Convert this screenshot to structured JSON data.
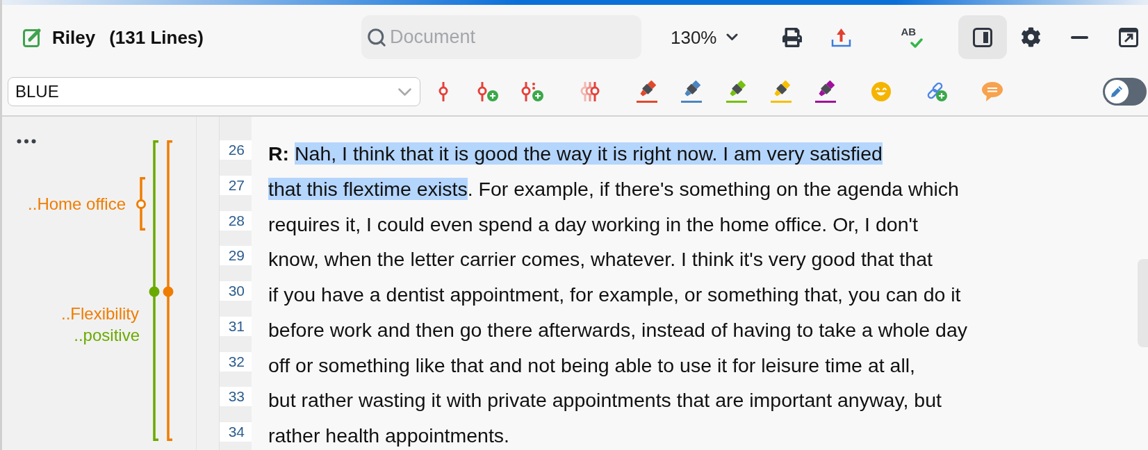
{
  "header": {
    "title": "Riley",
    "line_count": "(131 Lines)",
    "search": {
      "placeholder": "Document"
    },
    "zoom": "130%",
    "spellcheck": {
      "label": "AB"
    },
    "panel_toggle": {
      "on": true
    }
  },
  "toolbar": {
    "code_selector": {
      "value": "BLUE"
    },
    "highlighters": [
      {
        "color": "#e2482a"
      },
      {
        "color": "#4a86bf"
      },
      {
        "color": "#76c00e"
      },
      {
        "color": "#f6bf00"
      },
      {
        "color": "#a0109c"
      }
    ],
    "edit_mode": {
      "on": false
    }
  },
  "margin": {
    "codings": [
      {
        "label": "..Home office",
        "color": "#ef7d00",
        "kind": "hollow"
      },
      {
        "label": "..Flexibility",
        "color": "#ef7d00",
        "kind": "filled"
      },
      {
        "label": "..positive",
        "color": "#6aaa00",
        "kind": "filled"
      }
    ]
  },
  "transcript": {
    "lines": [
      {
        "number": "26",
        "segments": [
          {
            "text": "R: ",
            "kind": "speaker",
            "selected": false
          },
          {
            "text": "Nah, I think that it is good the way it is right now. I am very satisfied",
            "kind": "plain",
            "selected": true
          }
        ]
      },
      {
        "number": "27",
        "segments": [
          {
            "text": "that this flextime exists",
            "kind": "plain",
            "selected": true
          },
          {
            "text": ". For example, if there's something on the agenda which",
            "kind": "plain",
            "selected": false
          }
        ]
      },
      {
        "number": "28",
        "segments": [
          {
            "text": "requires it, I could even spend a day working in the home office. Or, I don't",
            "kind": "plain",
            "selected": false
          }
        ]
      },
      {
        "number": "29",
        "segments": [
          {
            "text": "know, when the letter carrier comes, whatever. I think it's very good that that",
            "kind": "plain",
            "selected": false
          }
        ]
      },
      {
        "number": "30",
        "segments": [
          {
            "text": "if you have a dentist appointment, for example, or something that, you can do it",
            "kind": "plain",
            "selected": false
          }
        ]
      },
      {
        "number": "31",
        "segments": [
          {
            "text": "before work and then go there afterwards, instead of having to take a whole day",
            "kind": "plain",
            "selected": false
          }
        ]
      },
      {
        "number": "32",
        "segments": [
          {
            "text": "off or something like that and not being able to use it for leisure time at all,",
            "kind": "plain",
            "selected": false
          }
        ]
      },
      {
        "number": "33",
        "segments": [
          {
            "text": "but rather wasting it with private appointments that are important anyway, but",
            "kind": "plain",
            "selected": false
          }
        ]
      },
      {
        "number": "34",
        "segments": [
          {
            "text": "rather health appointments.",
            "kind": "plain",
            "selected": false
          }
        ]
      }
    ]
  }
}
